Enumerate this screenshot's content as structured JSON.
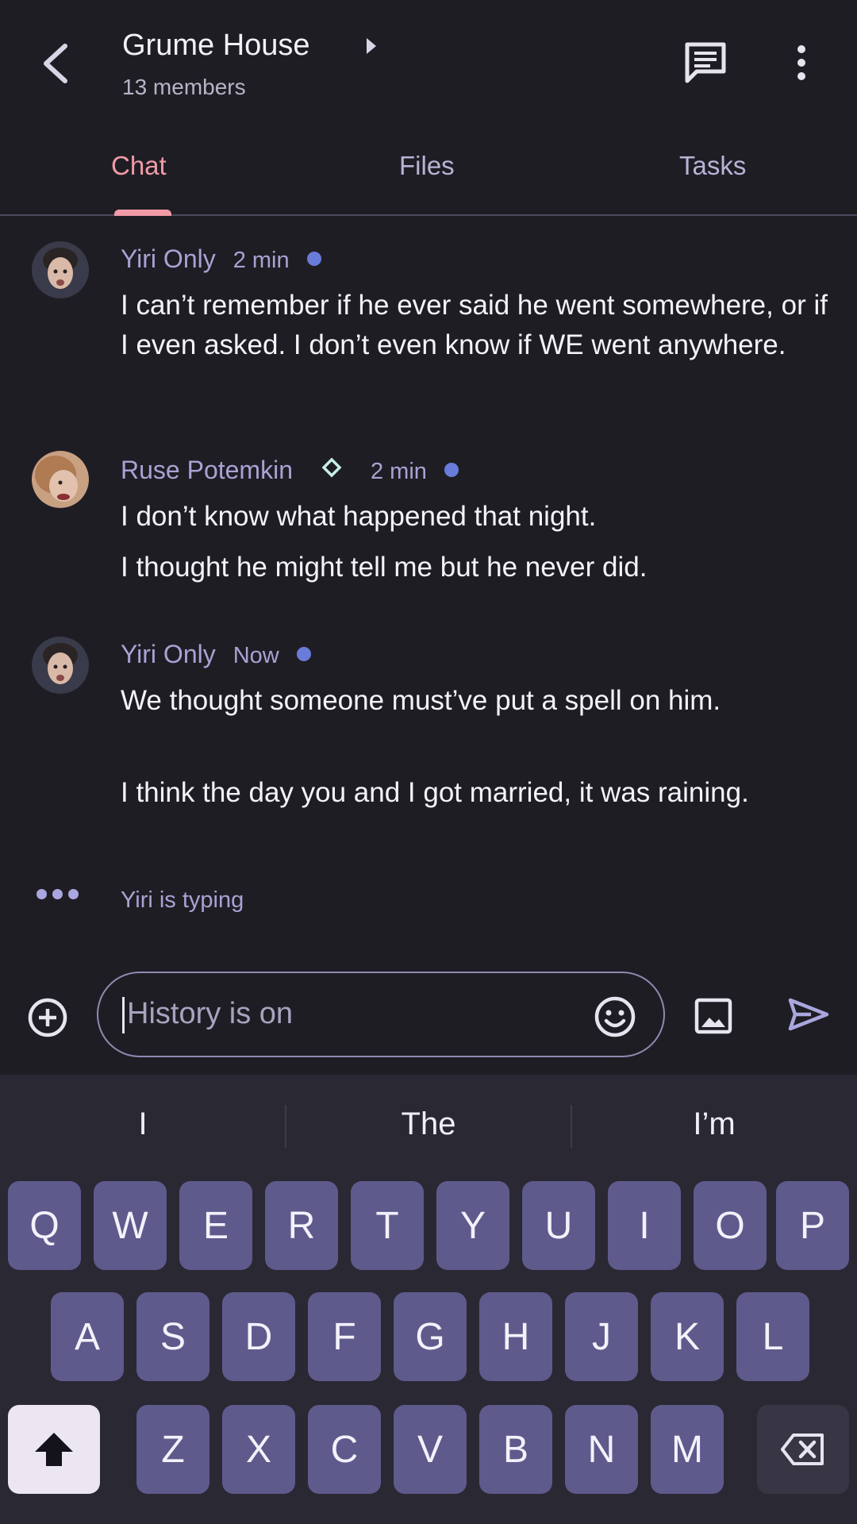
{
  "header": {
    "title": "Grume House",
    "subtitle": "13 members",
    "icons": {
      "back": "back-chevron-icon",
      "expand": "caret-right-icon",
      "chat": "chat-bubble-icon",
      "more": "more-vert-icon"
    }
  },
  "tabs": [
    {
      "label": "Chat",
      "active": true
    },
    {
      "label": "Files",
      "active": false
    },
    {
      "label": "Tasks",
      "active": false
    }
  ],
  "messages": [
    {
      "author": "Yiri Only",
      "time": "2 min",
      "lines": [
        "I can’t remember if he ever said he went somewhere, or if I even asked. I don’t even know if WE went anywhere."
      ]
    },
    {
      "author": "Ruse Potemkin",
      "time": "2 min",
      "badge_icon": "diamond-icon",
      "lines": [
        "I don’t know what happened that night.",
        "I thought he might tell me but he never did."
      ]
    },
    {
      "author": "Yiri Only",
      "time": "Now",
      "lines": [
        "We thought someone must’ve put a spell on him.",
        "I think the day you and I got married, it was raining."
      ]
    }
  ],
  "typing": {
    "label": "Yiri is typing"
  },
  "composer": {
    "placeholder": "History is on",
    "icons": {
      "add": "add-circle-icon",
      "emoji": "emoji-icon",
      "image": "image-icon",
      "send": "send-icon"
    }
  },
  "keyboard": {
    "suggestions": [
      "I",
      "The",
      "I’m"
    ],
    "row1": [
      "Q",
      "W",
      "E",
      "R",
      "T",
      "Y",
      "U",
      "I",
      "O",
      "P"
    ],
    "row2": [
      "A",
      "S",
      "D",
      "F",
      "G",
      "H",
      "J",
      "K",
      "L"
    ],
    "row3": [
      "Z",
      "X",
      "C",
      "V",
      "B",
      "N",
      "M"
    ],
    "icons": {
      "shift": "shift-icon",
      "delete": "backspace-icon"
    }
  },
  "colors": {
    "background": "#1f1d24",
    "accent": "#f19ba6",
    "tab_inactive": "#b6b3d6",
    "presence_dot": "#6a7cd9",
    "key": "#5f5a8c"
  }
}
